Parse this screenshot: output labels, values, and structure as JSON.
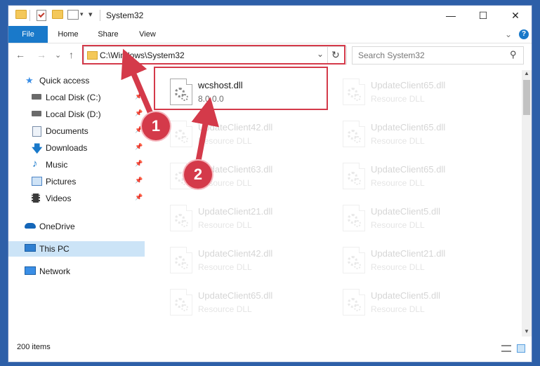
{
  "window": {
    "title": "System32",
    "minimize": "—",
    "maximize": "☐",
    "close": "✕"
  },
  "ribbon": {
    "tabs": [
      "File",
      "Home",
      "Share",
      "View"
    ],
    "expand_glyph": "⌄",
    "help_glyph": "?"
  },
  "nav": {
    "back": "←",
    "forward": "→",
    "recent": "⌄",
    "up": "↑",
    "address": "C:\\Windows\\System32",
    "address_dropdown": "⌄",
    "refresh": "↻",
    "search_placeholder": "Search System32",
    "search_glyph": "⚲"
  },
  "sidebar": {
    "items": [
      {
        "label": "Quick access",
        "icon": "star-icon"
      },
      {
        "label": "Local Disk (C:)",
        "icon": "drive-icon",
        "pinned": true
      },
      {
        "label": "Local Disk (D:)",
        "icon": "drive-icon",
        "pinned": true
      },
      {
        "label": "Documents",
        "icon": "documents-icon",
        "pinned": true
      },
      {
        "label": "Downloads",
        "icon": "download-icon",
        "pinned": true
      },
      {
        "label": "Music",
        "icon": "music-icon",
        "pinned": true
      },
      {
        "label": "Pictures",
        "icon": "pictures-icon",
        "pinned": true
      },
      {
        "label": "Videos",
        "icon": "videos-icon",
        "pinned": true
      },
      {
        "label": "OneDrive",
        "icon": "cloud-icon"
      },
      {
        "label": "This PC",
        "icon": "computer-icon",
        "selected": true
      },
      {
        "label": "Network",
        "icon": "network-icon"
      }
    ],
    "pin_glyph": "📌"
  },
  "files": [
    {
      "name": "wcshost.dll",
      "desc": "8.0.0.0"
    },
    {
      "name": "UpdateClient65.dll",
      "desc": "Resource DLL"
    },
    {
      "name": "UpdateClient42.dll",
      "desc": "Resource DLL"
    },
    {
      "name": "UpdateClient65.dll",
      "desc": "Resource DLL"
    },
    {
      "name": "UpdateClient63.dll",
      "desc": "Resource DLL"
    },
    {
      "name": "UpdateClient65.dll",
      "desc": "Resource DLL"
    },
    {
      "name": "UpdateClient21.dll",
      "desc": "Resource DLL"
    },
    {
      "name": "UpdateClient5.dll",
      "desc": "Resource DLL"
    },
    {
      "name": "UpdateClient42.dll",
      "desc": "Resource DLL"
    },
    {
      "name": "UpdateClient21.dll",
      "desc": "Resource DLL"
    },
    {
      "name": "UpdateClient65.dll",
      "desc": "Resource DLL"
    },
    {
      "name": "UpdateClient5.dll",
      "desc": "Resource DLL"
    }
  ],
  "status": {
    "items_count": "200 items"
  },
  "annotations": {
    "badge1": "1",
    "badge2": "2",
    "color": "#d43a4a"
  }
}
